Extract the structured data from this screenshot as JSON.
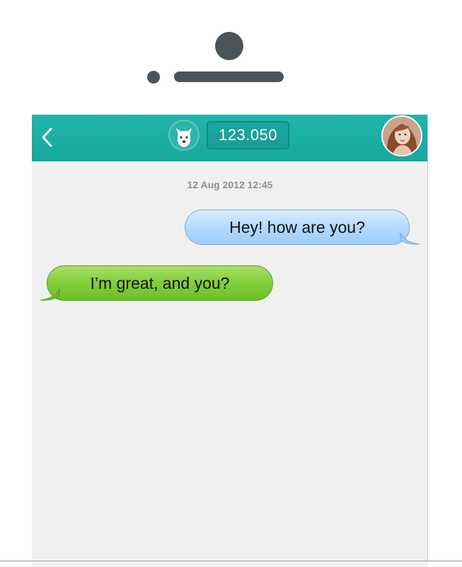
{
  "header": {
    "counter": "123.050"
  },
  "conversation": {
    "timestamp": "12 Aug 2012 12:45",
    "messages": [
      {
        "direction": "outgoing",
        "text": "Hey! how are you?"
      },
      {
        "direction": "incoming",
        "text": "I’m great, and you?"
      }
    ]
  },
  "icons": {
    "back": "chevron-left-icon",
    "avatar": "dog-icon",
    "profile": "profile-photo"
  },
  "colors": {
    "navbar": "#1aada3",
    "outgoing_bubble": "#b7dbfb",
    "incoming_bubble": "#84cf3c",
    "background": "#f0f0ef",
    "hardware": "#4b5459"
  }
}
